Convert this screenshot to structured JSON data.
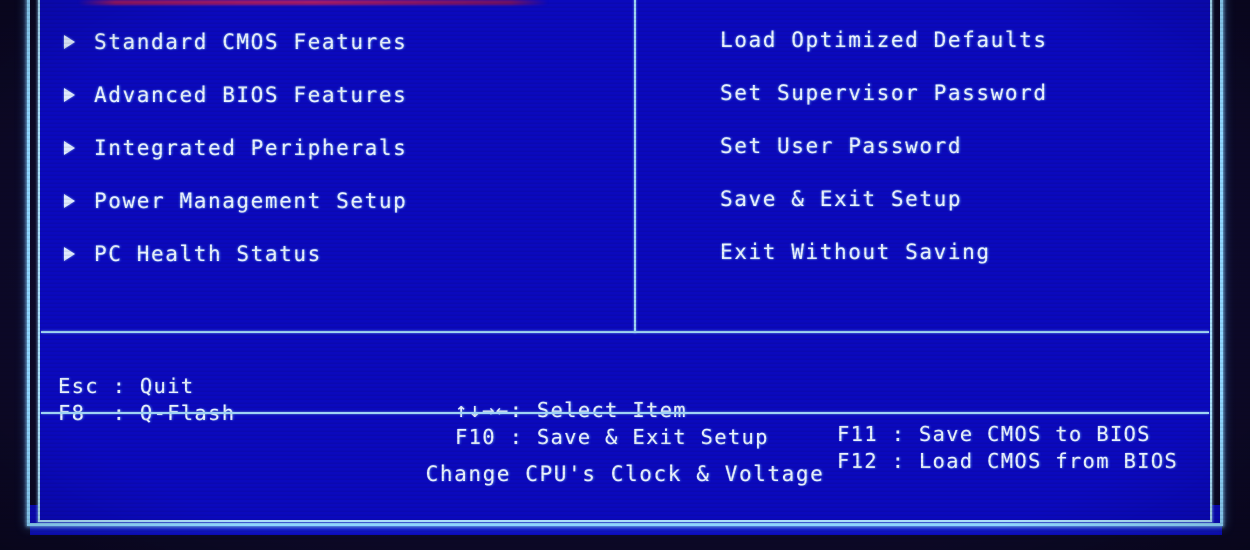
{
  "screen": {
    "background_color": "#0b09be",
    "border_color": "#9fd4f5",
    "text_color": "#e9f2ff"
  },
  "menu": {
    "left_column": [
      {
        "bullet": "right-triangle-bullet",
        "label": "Standard CMOS Features"
      },
      {
        "bullet": "right-triangle-bullet",
        "label": "Advanced BIOS Features"
      },
      {
        "bullet": "right-triangle-bullet",
        "label": "Integrated Peripherals"
      },
      {
        "bullet": "right-triangle-bullet",
        "label": "Power Management Setup"
      },
      {
        "bullet": "right-triangle-bullet",
        "label": "PC Health Status"
      }
    ],
    "right_column": [
      {
        "label": "Load Optimized Defaults"
      },
      {
        "label": "Set Supervisor Password"
      },
      {
        "label": "Set User Password"
      },
      {
        "label": "Save & Exit Setup"
      },
      {
        "label": "Exit Without Saving"
      }
    ]
  },
  "key_help": {
    "row1": {
      "col1": "Esc : Quit",
      "col2": "↑↓→←: Select Item",
      "col3": "F11 : Save CMOS to BIOS"
    },
    "row2": {
      "col1": "F8  : Q-Flash",
      "col2": "F10 : Save & Exit Setup",
      "col3": "F12 : Load CMOS from BIOS"
    }
  },
  "status_bar": {
    "text": "Change CPU's Clock & Voltage"
  }
}
